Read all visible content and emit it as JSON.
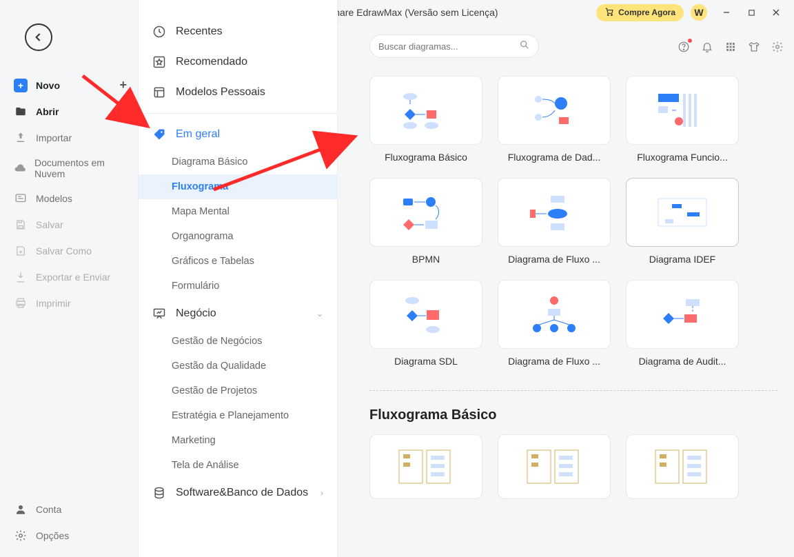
{
  "title": "Wondershare EdrawMax (Versão sem Licença)",
  "buy_now": "Compre Agora",
  "w_badge": "W",
  "sidebar": {
    "items": [
      {
        "name": "novo",
        "label": "Novo",
        "icon": "doc-new-icon",
        "active": true,
        "plus": true
      },
      {
        "name": "abrir",
        "label": "Abrir",
        "icon": "folder-icon",
        "active": true
      },
      {
        "name": "importar",
        "label": "Importar",
        "icon": "import-icon"
      },
      {
        "name": "nuvem",
        "label": "Documentos em Nuvem",
        "icon": "cloud-icon"
      },
      {
        "name": "modelos",
        "label": "Modelos",
        "icon": "templates-icon"
      },
      {
        "name": "salvar",
        "label": "Salvar",
        "icon": "save-icon",
        "disabled": true
      },
      {
        "name": "salvar-como",
        "label": "Salvar Como",
        "icon": "save-as-icon",
        "disabled": true
      },
      {
        "name": "exportar",
        "label": "Exportar e Enviar",
        "icon": "export-icon",
        "disabled": true
      },
      {
        "name": "imprimir",
        "label": "Imprimir",
        "icon": "print-icon",
        "disabled": true
      }
    ],
    "footer": [
      {
        "name": "conta",
        "label": "Conta",
        "icon": "user-icon"
      },
      {
        "name": "opcoes",
        "label": "Opções",
        "icon": "gear-icon"
      }
    ]
  },
  "panel": {
    "top": [
      {
        "label": "Recentes",
        "icon": "clock-icon"
      },
      {
        "label": "Recomendado",
        "icon": "star-box-icon"
      },
      {
        "label": "Modelos Pessoais",
        "icon": "template-icon"
      }
    ],
    "categories": [
      {
        "label": "Em geral",
        "icon": "tag-icon",
        "blue": true,
        "subs": [
          {
            "label": "Diagrama Básico"
          },
          {
            "label": "Fluxograma",
            "selected": true
          },
          {
            "label": "Mapa Mental"
          },
          {
            "label": "Organograma"
          },
          {
            "label": "Gráficos e Tabelas"
          },
          {
            "label": "Formulário"
          }
        ]
      },
      {
        "label": "Negócio",
        "icon": "presentation-icon",
        "subs": [
          {
            "label": "Gestão de Negócios"
          },
          {
            "label": "Gestão da Qualidade"
          },
          {
            "label": "Gestão de Projetos"
          },
          {
            "label": "Estratégia e Planejamento"
          },
          {
            "label": "Marketing"
          },
          {
            "label": "Tela de Análise"
          }
        ]
      },
      {
        "label": "Software&Banco de Dados",
        "icon": "database-icon",
        "subs": []
      }
    ]
  },
  "search_placeholder": "Buscar diagramas...",
  "template_cards": [
    {
      "label": "Fluxograma Básico"
    },
    {
      "label": "Fluxograma de Dad..."
    },
    {
      "label": "Fluxograma Funcio..."
    },
    {
      "label": "BPMN"
    },
    {
      "label": "Diagrama de Fluxo ..."
    },
    {
      "label": "Diagrama IDEF",
      "selected": true
    },
    {
      "label": "Diagrama SDL"
    },
    {
      "label": "Diagrama de Fluxo ..."
    },
    {
      "label": "Diagrama de Audit..."
    }
  ],
  "section_heading": "Fluxograma Básico",
  "example_templates": [
    {
      "label": ""
    },
    {
      "label": ""
    },
    {
      "label": ""
    }
  ]
}
